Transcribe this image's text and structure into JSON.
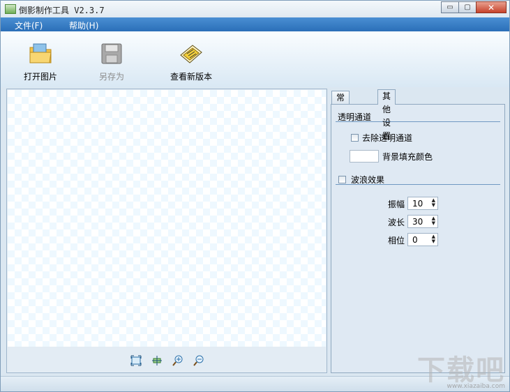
{
  "window": {
    "title": "倒影制作工具 V2.3.7",
    "minimize_glyph": "▭",
    "maximize_glyph": "▢",
    "close_glyph": "✕"
  },
  "menu": {
    "items": [
      {
        "label": "文件(F)"
      },
      {
        "label": "帮助(H)"
      }
    ]
  },
  "toolbar": {
    "open_image": "打开图片",
    "save_as": "另存为",
    "check_update": "查看新版本",
    "save_as_disabled": true
  },
  "canvas": {
    "tools": [
      {
        "icon": "fit-window-icon"
      },
      {
        "icon": "actual-size-icon"
      },
      {
        "icon": "zoom-in-icon"
      },
      {
        "icon": "zoom-out-icon"
      }
    ]
  },
  "settings": {
    "tabs": [
      {
        "label": "常规设置",
        "active": false
      },
      {
        "label": "其他设置",
        "active": true
      }
    ],
    "alpha_section": {
      "title": "透明通道",
      "remove_alpha_label": "去除透明通道",
      "remove_alpha_checked": false,
      "bg_fill_label": "背景填充颜色",
      "bg_fill_color": "#ffffff"
    },
    "wave_section": {
      "title": "波浪效果",
      "enabled": false,
      "amplitude_label": "振幅",
      "amplitude_value": "10",
      "wavelength_label": "波长",
      "wavelength_value": "30",
      "phase_label": "相位",
      "phase_value": "0"
    }
  },
  "watermark": {
    "logo_text": "下载吧",
    "url_text": "www.xiazaiba.com"
  },
  "colors": {
    "menubar": "#2f74bd",
    "section_line": "#6f98c2",
    "checker": "#eef8ff"
  }
}
